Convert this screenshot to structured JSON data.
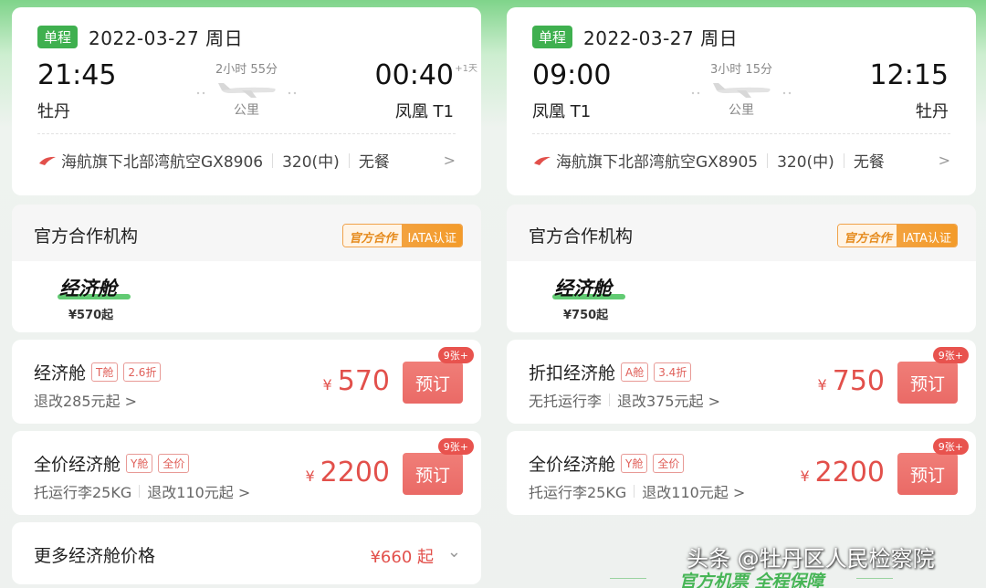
{
  "columns": [
    {
      "flight": {
        "badge": "单程",
        "date": "2022-03-27 周日",
        "dep_time": "21:45",
        "dep_city": "牡丹",
        "duration": "2小时 55分",
        "distance": "公里",
        "arr_time": "00:40",
        "arr_next_day": "+1天",
        "arr_city": "凤凰 T1",
        "airline": "海航旗下北部湾航空GX8906",
        "aircraft": "320(中)",
        "meal": "无餐"
      },
      "partner": {
        "title": "官方合作机构",
        "badge_official": "官方合作",
        "badge_iata": "IATA认证"
      },
      "cabin_tab": {
        "name": "经济舱",
        "price": "¥570起"
      },
      "fares": [
        {
          "title": "经济舱",
          "tags": [
            "T舱",
            "2.6折"
          ],
          "sub": [
            "退改285元起 >"
          ],
          "yen": "¥",
          "price": "570",
          "book": "预订",
          "stock": "9张+"
        },
        {
          "title": "全价经济舱",
          "tags": [
            "Y舱",
            "全价"
          ],
          "sub": [
            "托运行李25KG",
            "退改110元起 >"
          ],
          "yen": "¥",
          "price": "2200",
          "book": "预订",
          "stock": "9张+"
        }
      ],
      "more": {
        "title": "更多经济舱价格",
        "price": "¥660 起"
      }
    },
    {
      "flight": {
        "badge": "单程",
        "date": "2022-03-27 周日",
        "dep_time": "09:00",
        "dep_city": "凤凰 T1",
        "duration": "3小时 15分",
        "distance": "公里",
        "arr_time": "12:15",
        "arr_city": "牡丹",
        "airline": "海航旗下北部湾航空GX8905",
        "aircraft": "320(中)",
        "meal": "无餐"
      },
      "partner": {
        "title": "官方合作机构",
        "badge_official": "官方合作",
        "badge_iata": "IATA认证"
      },
      "cabin_tab": {
        "name": "经济舱",
        "price": "¥750起"
      },
      "fares": [
        {
          "title": "折扣经济舱",
          "tags": [
            "A舱",
            "3.4折"
          ],
          "sub": [
            "无托运行李",
            "退改375元起 >"
          ],
          "yen": "¥",
          "price": "750",
          "book": "预订",
          "stock": "9张+"
        },
        {
          "title": "全价经济舱",
          "tags": [
            "Y舱",
            "全价"
          ],
          "sub": [
            "托运行李25KG",
            "退改110元起 >"
          ],
          "yen": "¥",
          "price": "2200",
          "book": "预订",
          "stock": "9张+"
        }
      ]
    }
  ],
  "watermark": "头条 @牡丹区人民检察院",
  "slogan": "官方机票 全程保障",
  "colors": {
    "green": "#3fb04f",
    "price_red": "#e2504b",
    "book_button": "#ea6a66",
    "iata_orange": "#f3a23e"
  }
}
